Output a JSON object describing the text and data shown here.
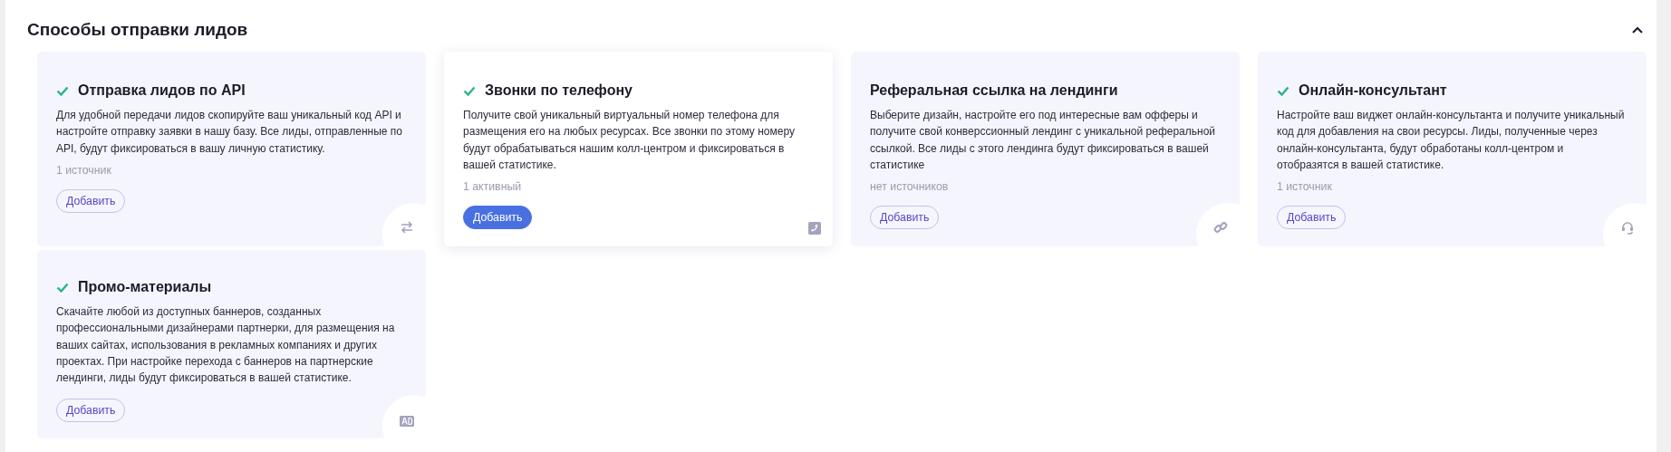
{
  "section": {
    "title": "Способы отправки лидов",
    "expanded": true
  },
  "cards": [
    {
      "title": "Отправка лидов по API",
      "checked": true,
      "selected": false,
      "kind": "arrows",
      "description": "Для удобной передачи лидов скопируйте ваш уникальный код API и настройте отправку заявки в нашу базу. Все лиды, отправленные по API, будут фиксироваться в вашу личную статистику.",
      "status": "1 источник",
      "button": "Добавить"
    },
    {
      "title": "Звонки по телефону",
      "checked": true,
      "selected": true,
      "kind": "phone",
      "description": "Получите свой уникальный виртуальный номер телефона для размещения его на любых ресурсах. Все звонки по этому номеру будут обрабатываться нашим колл-центром и фиксироваться в вашей статистике.",
      "status": "1 активный",
      "button": "Добавить"
    },
    {
      "title": "Реферальная ссылка на лендинги",
      "checked": false,
      "selected": false,
      "kind": "link",
      "description": "Выберите дизайн, настройте его под интересные вам офферы и получите свой конверссионный лендинг с уникальной реферальной ссылкой. Все лиды с этого лендинга будут фиксироваться в вашей статистике",
      "status": "нет источников",
      "button": "Добавить"
    },
    {
      "title": "Онлайн-консультант",
      "checked": true,
      "selected": false,
      "kind": "headset",
      "description": "Настройте ваш виджет онлайн-консультанта и получите уникальный код для добавления на свои ресурсы. Лиды, полученные через онлайн-консультанта, будут обработаны колл-центром и отобразятся в вашей статистике.",
      "status": "1 источник",
      "button": "Добавить"
    },
    {
      "title": "Промо-материалы",
      "checked": true,
      "selected": false,
      "kind": "ad",
      "description": "Скачайте любой из доступных баннеров, созданных профессиональными дизайнерами партнерки, для размещения на ваших сайтах, использования в рекламных компаниях и других проектах. При настройке перехода с баннеров на партнерские лендинги, лиды будут фиксироваться в вашей статистике.",
      "button": "Добавить"
    }
  ]
}
